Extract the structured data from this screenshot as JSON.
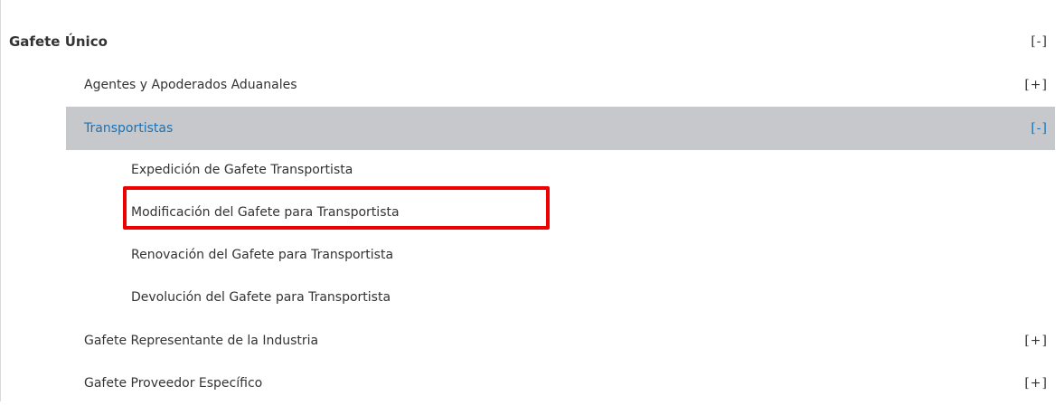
{
  "menu": {
    "section": {
      "label": "Gafete Único",
      "toggle": "[-]"
    },
    "items": [
      {
        "label": "Agentes y Apoderados Aduanales",
        "toggle": "[+]"
      },
      {
        "label": "Transportistas",
        "toggle": "[-]",
        "children": [
          {
            "label": "Expedición de Gafete Transportista"
          },
          {
            "label": "Modificación del Gafete para Transportista"
          },
          {
            "label": "Renovación del Gafete para Transportista"
          },
          {
            "label": "Devolución del Gafete para Transportista"
          }
        ]
      },
      {
        "label": "Gafete Representante de la Industria",
        "toggle": "[+]"
      },
      {
        "label": "Gafete Proveedor Específico",
        "toggle": "[+]"
      }
    ]
  },
  "colors": {
    "active_background": "#c6c8cb",
    "active_text": "#1a73b8",
    "highlight_border": "#ee0000"
  }
}
